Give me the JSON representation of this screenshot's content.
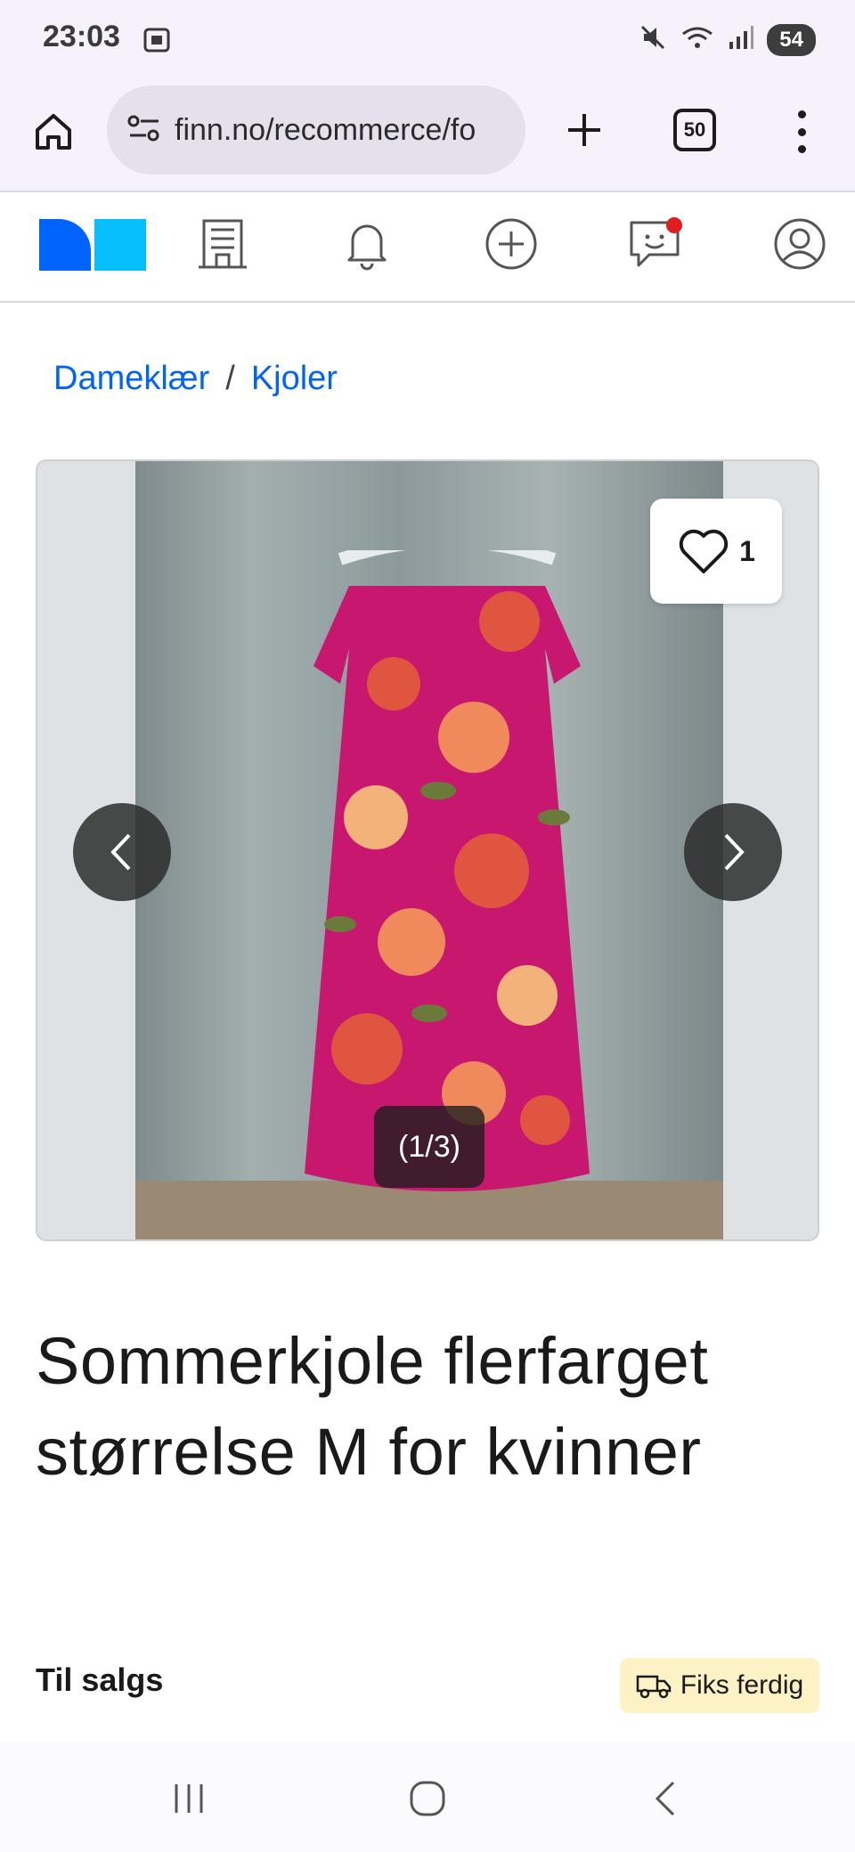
{
  "status_bar": {
    "time": "23:03",
    "battery": "54"
  },
  "browser": {
    "url": "finn.no/recommerce/fo",
    "tab_count": "50"
  },
  "breadcrumbs": [
    {
      "label": "Dameklær"
    },
    {
      "label": "Kjoler"
    }
  ],
  "breadcrumb_separator": "/",
  "gallery": {
    "favorite_count": "1",
    "counter": "(1/3)"
  },
  "listing": {
    "title": "Sommerkjole flerfarget størrelse M for kvinner",
    "status": "Til salgs",
    "shipping_badge": "Fiks ferdig"
  },
  "colors": {
    "accent": "#0063fb",
    "logo_secondary": "#06bffc",
    "badge_bg": "#fdf2c6",
    "notification": "#e01c1c"
  }
}
